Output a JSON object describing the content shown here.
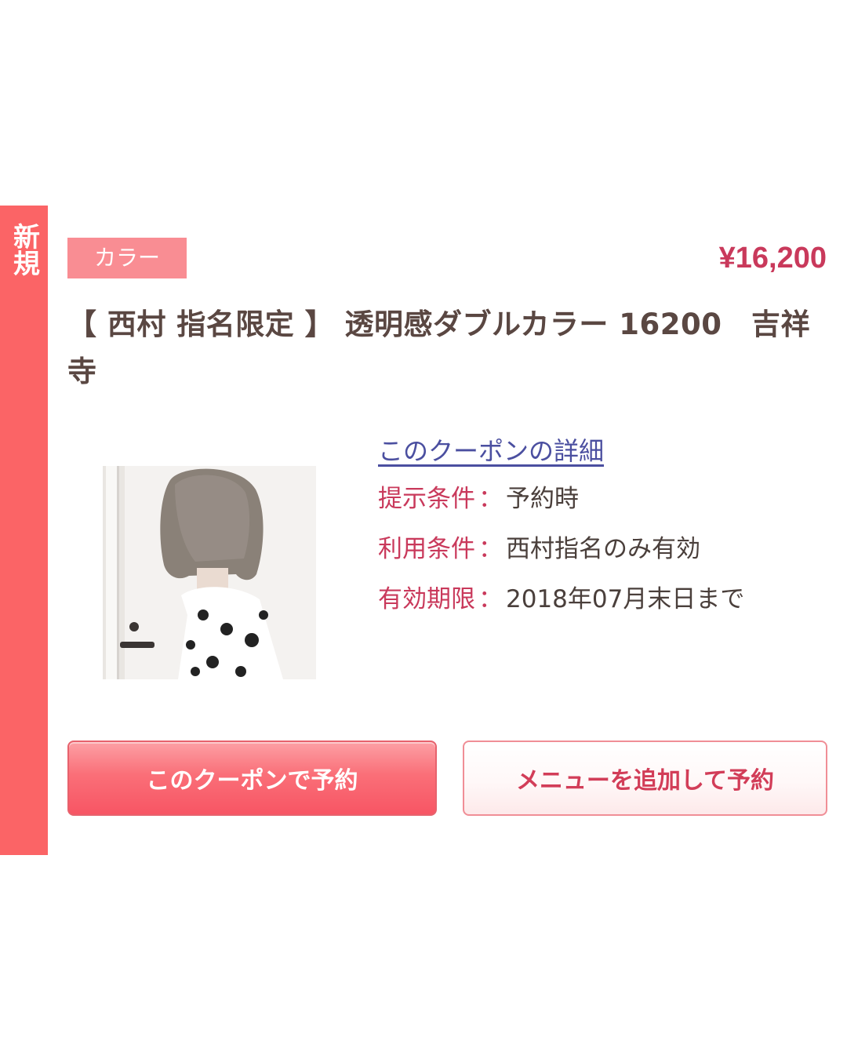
{
  "side_tag": {
    "label": "新規"
  },
  "coupon": {
    "category": "カラー",
    "price": "¥16,200",
    "title": "【 西村 指名限定 】 透明感ダブルカラー 16200　吉祥寺",
    "detail_link": "このクーポンの詳細",
    "conditions": [
      {
        "label": "提示条件",
        "separator": "：",
        "value": "予約時"
      },
      {
        "label": "利用条件",
        "separator": "：",
        "value": "西村指名のみ有効"
      },
      {
        "label": "有効期限",
        "separator": "：",
        "value": "2018年07月末日まで"
      }
    ]
  },
  "buttons": {
    "reserve_with_coupon": "このクーポンで予約",
    "add_menu_and_reserve": "メニューを追加して予約"
  },
  "colors": {
    "accent_red": "#fb6466",
    "badge_pink": "#f98d93",
    "price_red": "#c9395b",
    "link_blue": "#4b4fa0"
  }
}
